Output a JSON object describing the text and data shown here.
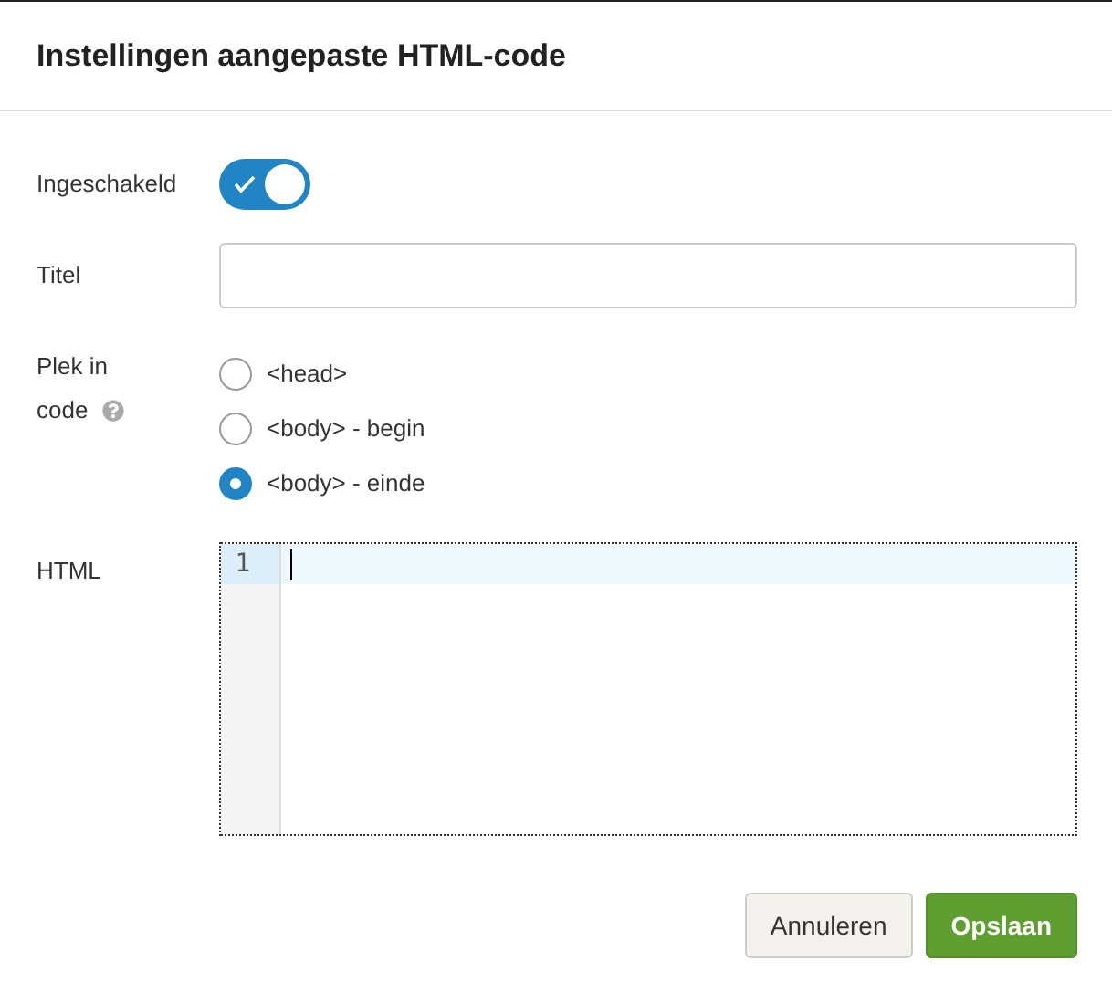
{
  "dialog": {
    "title": "Instellingen aangepaste HTML-code"
  },
  "enabled": {
    "label": "Ingeschakeld",
    "on": true
  },
  "title_field": {
    "label": "Titel"
  },
  "placement": {
    "label_lines": [
      "Plek in",
      "code"
    ],
    "help": true,
    "options": [
      {
        "label": "<head>",
        "selected": false
      },
      {
        "label": "<body> - begin",
        "selected": false
      },
      {
        "label": "<body> - einde",
        "selected": true
      }
    ]
  },
  "html": {
    "label": "HTML",
    "line_numbers": [
      "1"
    ]
  },
  "buttons": [
    {
      "label": "Annuleren",
      "kind": "secondary"
    },
    {
      "label": "Opslaan",
      "kind": "primary"
    }
  ]
}
